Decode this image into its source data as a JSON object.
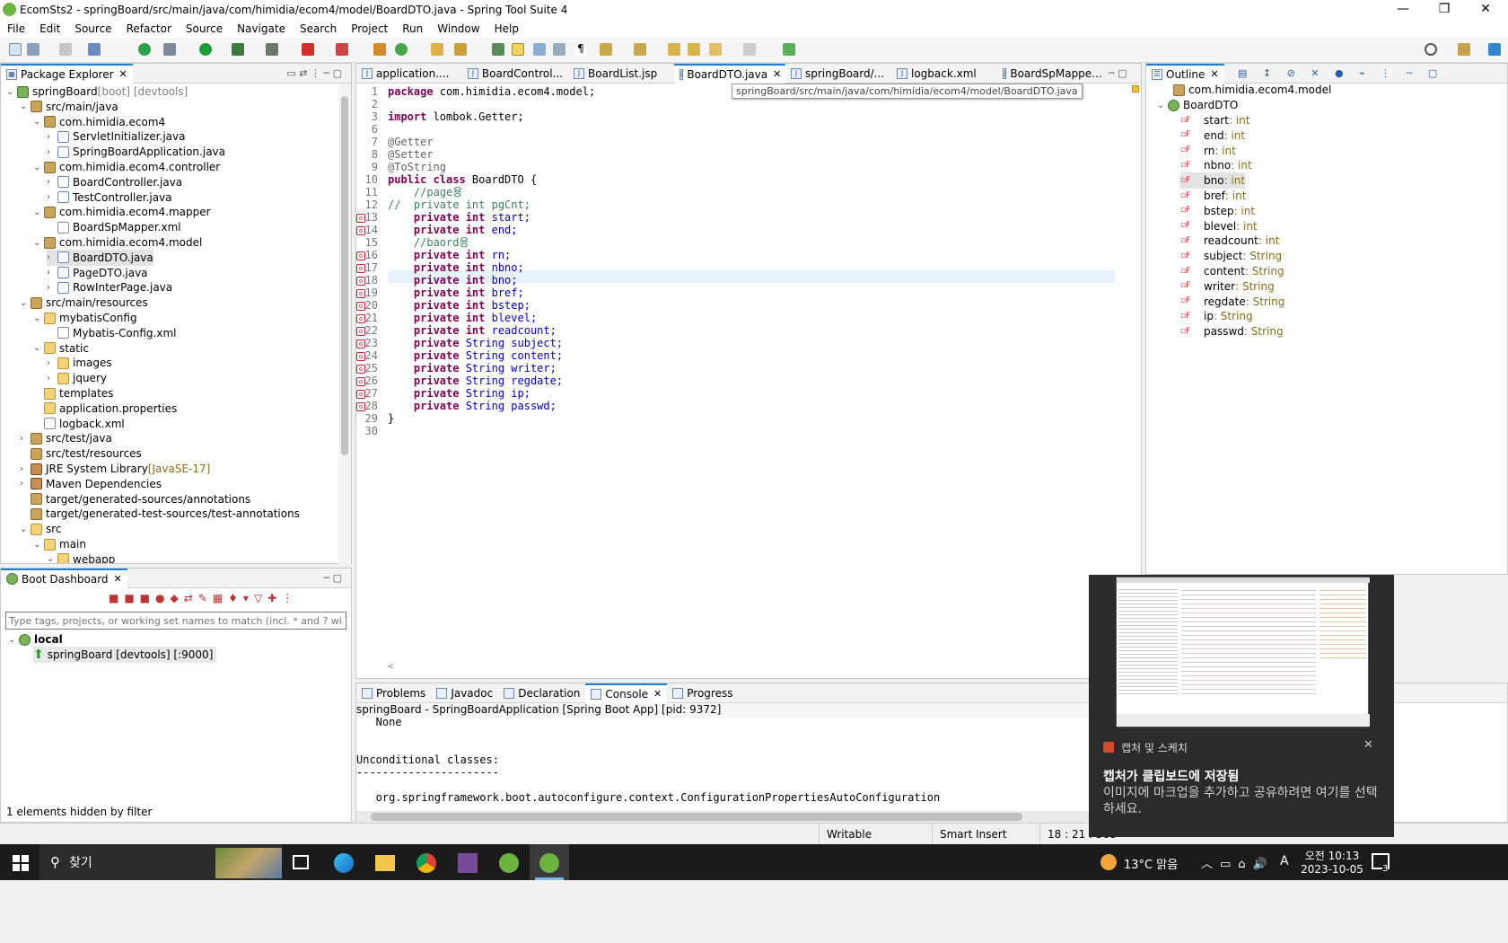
{
  "window": {
    "title": "EcomSts2 - springBoard/src/main/java/com/himidia/ecom4/model/BoardDTO.java - Spring Tool Suite 4",
    "minimize": "—",
    "maximize": "❐",
    "close": "✕"
  },
  "menu": [
    "File",
    "Edit",
    "Source",
    "Refactor",
    "Source",
    "Navigate",
    "Search",
    "Project",
    "Run",
    "Window",
    "Help"
  ],
  "package_explorer": {
    "title": "Package Explorer",
    "items": [
      {
        "label": "springBoard",
        "suffix": " [boot] [devtools]",
        "icon": "project-icon"
      },
      {
        "label": "src/main/java",
        "suffix": "",
        "icon": "source-folder-icon"
      },
      {
        "label": "com.himidia.ecom4",
        "suffix": "",
        "icon": "package-icon"
      },
      {
        "label": "ServletInitializer.java",
        "suffix": "",
        "icon": "java-file-icon"
      },
      {
        "label": "SpringBoardApplication.java",
        "suffix": "",
        "icon": "java-file-icon"
      },
      {
        "label": "com.himidia.ecom4.controller",
        "suffix": "",
        "icon": "package-icon"
      },
      {
        "label": "BoardController.java",
        "suffix": "",
        "icon": "java-file-icon"
      },
      {
        "label": "TestController.java",
        "suffix": "",
        "icon": "java-file-icon"
      },
      {
        "label": "com.himidia.ecom4.mapper",
        "suffix": "",
        "icon": "package-icon"
      },
      {
        "label": "BoardSpMapper.xml",
        "suffix": "",
        "icon": "xml-file-icon"
      },
      {
        "label": "com.himidia.ecom4.model",
        "suffix": "",
        "icon": "package-icon"
      },
      {
        "label": "BoardDTO.java",
        "suffix": "",
        "icon": "java-file-icon"
      },
      {
        "label": "PageDTO.java",
        "suffix": "",
        "icon": "java-file-icon"
      },
      {
        "label": "RowInterPage.java",
        "suffix": "",
        "icon": "java-interface-icon"
      },
      {
        "label": "src/main/resources",
        "suffix": "",
        "icon": "source-folder-icon"
      },
      {
        "label": "mybatisConfig",
        "suffix": "",
        "icon": "folder-icon"
      },
      {
        "label": "Mybatis-Config.xml",
        "suffix": "",
        "icon": "xml-file-icon"
      },
      {
        "label": "static",
        "suffix": "",
        "icon": "folder-icon"
      },
      {
        "label": "images",
        "suffix": "",
        "icon": "folder-icon"
      },
      {
        "label": "jquery",
        "suffix": "",
        "icon": "folder-icon"
      },
      {
        "label": "templates",
        "suffix": "",
        "icon": "folder-icon"
      },
      {
        "label": "application.properties",
        "suffix": "",
        "icon": "properties-file-icon"
      },
      {
        "label": "logback.xml",
        "suffix": "",
        "icon": "xml-file-icon"
      },
      {
        "label": "src/test/java",
        "suffix": "",
        "icon": "source-folder-icon"
      },
      {
        "label": "src/test/resources",
        "suffix": "",
        "icon": "source-folder-icon"
      },
      {
        "label": "JRE System Library",
        "suffix": " [JavaSE-17]",
        "icon": "library-icon"
      },
      {
        "label": "Maven Dependencies",
        "suffix": "",
        "icon": "library-icon"
      },
      {
        "label": "target/generated-sources/annotations",
        "suffix": "",
        "icon": "source-folder-icon"
      },
      {
        "label": "target/generated-test-sources/test-annotations",
        "suffix": "",
        "icon": "source-folder-icon"
      },
      {
        "label": "src",
        "suffix": "",
        "icon": "folder-icon"
      },
      {
        "label": "main",
        "suffix": "",
        "icon": "folder-icon"
      },
      {
        "label": "webapp",
        "suffix": "",
        "icon": "folder-icon"
      }
    ]
  },
  "boot_dashboard": {
    "title": "Boot Dashboard",
    "filter_placeholder": "Type tags, projects, or working set names to match (incl. * and ? wildcards)",
    "group": "local",
    "app": "springBoard [devtools] [:9000]",
    "footer": "1 elements hidden by filter"
  },
  "editor": {
    "tabs": [
      "application....",
      "BoardControl...",
      "BoardList.jsp",
      "BoardDTO.java",
      "springBoard/...",
      "logback.xml",
      "BoardSpMappe..."
    ],
    "tooltip": "springBoard/src/main/java/com/himidia/ecom4/model/BoardDTO.java",
    "line_numbers": [
      "1",
      "2",
      "3",
      "6",
      "7",
      "8",
      "9",
      "10",
      "11",
      "12",
      "13",
      "14",
      "15",
      "16",
      "17",
      "18",
      "19",
      "20",
      "21",
      "22",
      "23",
      "24",
      "25",
      "26",
      "27",
      "28",
      "29",
      "30"
    ],
    "lines": [
      {
        "kw": "package",
        "rest": " com.himidia.ecom4.model;",
        "t": "plain"
      },
      {
        "kw": "",
        "rest": "",
        "t": "plain"
      },
      {
        "kw": "import",
        "rest": " lombok.Getter;",
        "t": "plain"
      },
      {
        "kw": "",
        "rest": "",
        "t": "plain"
      },
      {
        "kw": "",
        "rest": "@Getter",
        "t": "ann"
      },
      {
        "kw": "",
        "rest": "@Setter",
        "t": "ann"
      },
      {
        "kw": "",
        "rest": "@ToString",
        "t": "ann"
      },
      {
        "kw": "public class",
        "rest": " BoardDTO {",
        "t": "plain"
      },
      {
        "kw": "",
        "rest": "    //page용",
        "t": "cmt"
      },
      {
        "kw": "",
        "rest": "//  private int pgCnt;",
        "t": "cmt"
      },
      {
        "kw": "    private int",
        "rest": " start;",
        "t": "fld"
      },
      {
        "kw": "    private int",
        "rest": " end;",
        "t": "fld"
      },
      {
        "kw": "",
        "rest": "    //baord용",
        "t": "cmt"
      },
      {
        "kw": "    private int",
        "rest": " rn;",
        "t": "fld"
      },
      {
        "kw": "    private int",
        "rest": " nbno;",
        "t": "fld"
      },
      {
        "kw": "    private int",
        "rest": " bno;",
        "t": "fld"
      },
      {
        "kw": "    private int",
        "rest": " bref;",
        "t": "fld"
      },
      {
        "kw": "    private int",
        "rest": " bstep;",
        "t": "fld"
      },
      {
        "kw": "    private int",
        "rest": " blevel;",
        "t": "fld"
      },
      {
        "kw": "    private int",
        "rest": " readcount;",
        "t": "fld"
      },
      {
        "kw": "    private",
        "rest": " String subject;",
        "t": "fld"
      },
      {
        "kw": "    private",
        "rest": " String content;",
        "t": "fld"
      },
      {
        "kw": "    private",
        "rest": " String writer;",
        "t": "fld"
      },
      {
        "kw": "    private",
        "rest": " String regdate;",
        "t": "fld"
      },
      {
        "kw": "    private",
        "rest": " String ip;",
        "t": "fld"
      },
      {
        "kw": "    private",
        "rest": " String passwd;",
        "t": "fld"
      },
      {
        "kw": "",
        "rest": "}",
        "t": "plain"
      },
      {
        "kw": "",
        "rest": "",
        "t": "plain"
      }
    ]
  },
  "outline": {
    "title": "Outline",
    "package": "com.himidia.ecom4.model",
    "class": "BoardDTO",
    "fields": [
      {
        "name": "start",
        "type": " : int"
      },
      {
        "name": "end",
        "type": " : int"
      },
      {
        "name": "rn",
        "type": " : int"
      },
      {
        "name": "nbno",
        "type": " : int"
      },
      {
        "name": "bno",
        "type": " : int"
      },
      {
        "name": "bref",
        "type": " : int"
      },
      {
        "name": "bstep",
        "type": " : int"
      },
      {
        "name": "blevel",
        "type": " : int"
      },
      {
        "name": "readcount",
        "type": " : int"
      },
      {
        "name": "subject",
        "type": " : String"
      },
      {
        "name": "content",
        "type": " : String"
      },
      {
        "name": "writer",
        "type": " : String"
      },
      {
        "name": "regdate",
        "type": " : String"
      },
      {
        "name": "ip",
        "type": " : String"
      },
      {
        "name": "passwd",
        "type": " : String"
      }
    ]
  },
  "bottom_panel": {
    "tabs": [
      "Problems",
      "Javadoc",
      "Declaration",
      "Console",
      "Progress"
    ],
    "console_header": "springBoard - SpringBoardApplication [Spring Boot App]  [pid: 9372]",
    "console_lines": [
      "   None",
      "",
      "",
      "Unconditional classes:",
      "----------------------",
      "",
      "   org.springframework.boot.autoconfigure.context.ConfigurationPropertiesAutoConfiguration"
    ]
  },
  "status": {
    "writable": "Writable",
    "insert": "Smart Insert",
    "position": "18 : 21 : 308"
  },
  "toast": {
    "app": "캡처 및 스케치",
    "title": "캡처가 클립보드에 저장됨",
    "body": "이미지에 마크업을 추가하고 공유하려면 여기를 선택하세요."
  },
  "taskbar": {
    "search": "찾기",
    "weather": "13°C 맑음",
    "ime": "A",
    "time": "오전 10:13",
    "date": "2023-10-05",
    "notification_count": "3"
  },
  "colors": {
    "accent": "#1f7fd4",
    "keyword": "#7f0055",
    "field": "#0000c0",
    "comment": "#3f7f5f"
  }
}
